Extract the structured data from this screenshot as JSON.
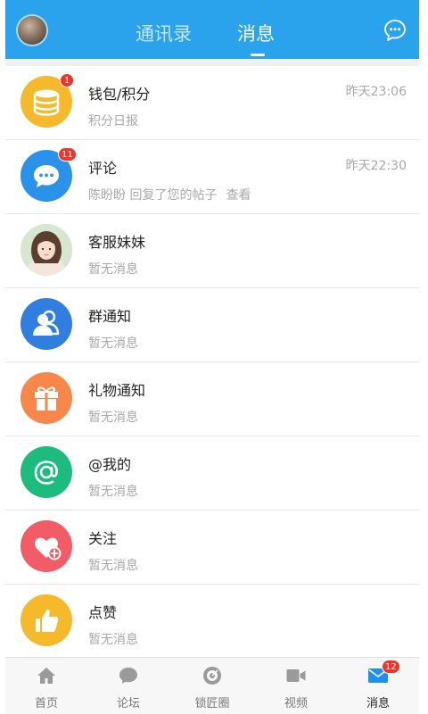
{
  "header": {
    "tabs": [
      {
        "label": "通讯录",
        "active": false
      },
      {
        "label": "消息",
        "active": true
      }
    ],
    "avatar_icon": "user-avatar",
    "chat_icon": "chat-bubble-icon"
  },
  "messages": [
    {
      "title": "钱包/积分",
      "subtitle": "积分日报",
      "time": "昨天23:06",
      "badge": "1",
      "icon": "wallet-coins-icon",
      "color": "#f6b92c"
    },
    {
      "title": "评论",
      "subtitle": "陈盼盼 回复了您的帖子",
      "link": "查看",
      "time": "昨天22:30",
      "badge": "11",
      "icon": "comment-icon",
      "color": "#2b92ea"
    },
    {
      "title": "客服妹妹",
      "subtitle": "暂无消息",
      "icon": "support-avatar",
      "color": "#e9d6c6"
    },
    {
      "title": "群通知",
      "subtitle": "暂无消息",
      "icon": "group-icon",
      "color": "#2f7ee0"
    },
    {
      "title": "礼物通知",
      "subtitle": "暂无消息",
      "icon": "gift-icon",
      "color": "#f7884a"
    },
    {
      "title": "@我的",
      "subtitle": "暂无消息",
      "icon": "at-icon",
      "color": "#1dbb7d"
    },
    {
      "title": "关注",
      "subtitle": "暂无消息",
      "icon": "heart-plus-icon",
      "color": "#f25c66"
    },
    {
      "title": "点赞",
      "subtitle": "暂无消息",
      "icon": "thumbs-up-icon",
      "color": "#f6b92c"
    }
  ],
  "tabbar": [
    {
      "label": "首页",
      "icon": "home-icon",
      "active": false
    },
    {
      "label": "论坛",
      "icon": "forum-icon",
      "active": false
    },
    {
      "label": "锁匠圈",
      "icon": "target-icon",
      "active": false
    },
    {
      "label": "视频",
      "icon": "video-icon",
      "active": false
    },
    {
      "label": "消息",
      "icon": "mail-icon",
      "active": true,
      "badge": "12"
    }
  ],
  "colors": {
    "header": "#2aa3ec",
    "badge": "#f0342c",
    "accent": "#1e90f0"
  }
}
